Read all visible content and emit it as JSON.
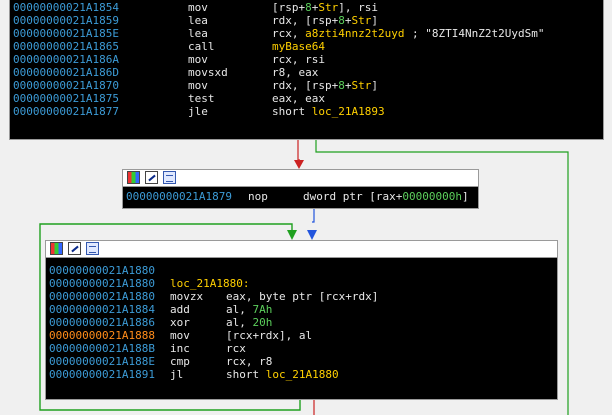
{
  "block1": {
    "lines": [
      {
        "addr": "00000000021A1854",
        "mn": "mov",
        "op": "[rsp+8+Str], rsi",
        "cm": ""
      },
      {
        "addr": "00000000021A1859",
        "mn": "lea",
        "op": "rdx, [rsp+8+Str]",
        "cm": ""
      },
      {
        "addr": "00000000021A185E",
        "mn": "lea",
        "op": "rcx, a8zti4nnz2t2uyd",
        "cm": "; \"8ZTI4NnZ2t2UydSm\""
      },
      {
        "addr": "00000000021A1865",
        "mn": "call",
        "op": "myBase64",
        "cm": ""
      },
      {
        "addr": "00000000021A186A",
        "mn": "mov",
        "op": "rcx, rsi",
        "cm": ""
      },
      {
        "addr": "00000000021A186D",
        "mn": "movsxd",
        "op": "r8, eax",
        "cm": ""
      },
      {
        "addr": "00000000021A1870",
        "mn": "mov",
        "op": "rdx, [rsp+8+Str]",
        "cm": ""
      },
      {
        "addr": "00000000021A1875",
        "mn": "test",
        "op": "eax, eax",
        "cm": ""
      },
      {
        "addr": "00000000021A1877",
        "mn": "jle",
        "op": "short loc_21A1893",
        "cm": ""
      }
    ]
  },
  "block2": {
    "lines": [
      {
        "addr": "00000000021A1879",
        "mn": "nop",
        "op": "dword ptr [rax+00000000h]",
        "cm": ""
      }
    ]
  },
  "block3": {
    "lines": [
      {
        "addr": "00000000021A1880",
        "mn": "",
        "op": "",
        "cm": ""
      },
      {
        "addr": "00000000021A1880",
        "mn": "loc_21A1880:",
        "op": "",
        "cm": ""
      },
      {
        "addr": "00000000021A1880",
        "mn": "movzx",
        "op": "eax, byte ptr [rcx+rdx]",
        "cm": ""
      },
      {
        "addr": "00000000021A1884",
        "mn": "add",
        "op": "al, 7Ah",
        "cm": ""
      },
      {
        "addr": "00000000021A1886",
        "mn": "xor",
        "op": "al, 20h",
        "cm": ""
      },
      {
        "addr": "00000000021A1888",
        "mn": "mov",
        "op": "[rcx+rdx], al",
        "cm": ""
      },
      {
        "addr": "00000000021A188B",
        "mn": "inc",
        "op": "rcx",
        "cm": ""
      },
      {
        "addr": "00000000021A188E",
        "mn": "cmp",
        "op": "rcx, r8",
        "cm": ""
      },
      {
        "addr": "00000000021A1891",
        "mn": "jl",
        "op": "short loc_21A1880",
        "cm": ""
      }
    ]
  },
  "colors": {
    "address": "#3c9bd6",
    "highlight_address": "#ff8c1a",
    "text": "#e8e8e8",
    "name": "#ffd000",
    "number": "#5ccf5c",
    "edge_true": "#1fa01f",
    "edge_false": "#cc2222",
    "edge_normal": "#2255dd"
  },
  "icons": [
    "color-palette-icon",
    "edit-pen-icon",
    "graph-view-icon"
  ]
}
